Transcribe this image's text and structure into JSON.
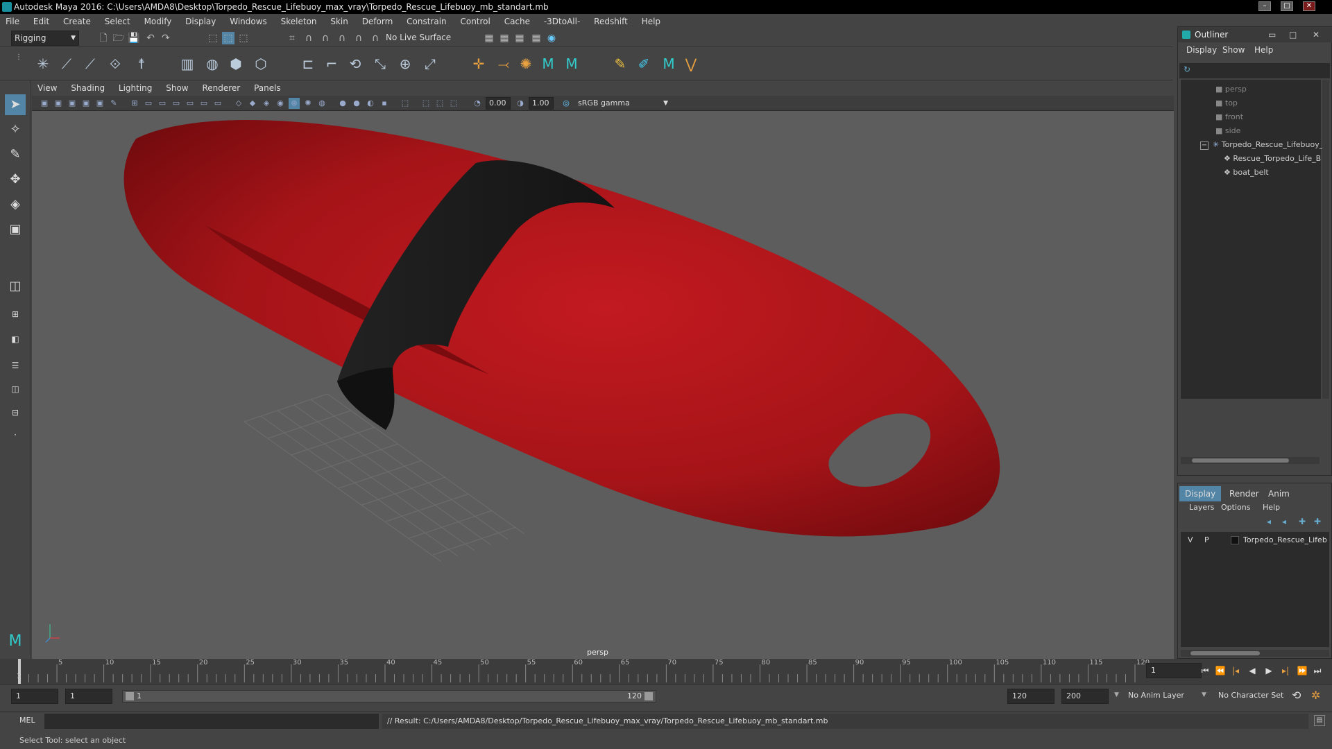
{
  "window": {
    "title": "Autodesk Maya 2016: C:\\Users\\AMDA8\\Desktop\\Torpedo_Rescue_Lifebuoy_max_vray\\Torpedo_Rescue_Lifebuoy_mb_standart.mb",
    "minimize": "–",
    "maximize": "□",
    "close": "✕"
  },
  "menubar": [
    "File",
    "Edit",
    "Create",
    "Select",
    "Modify",
    "Display",
    "Windows",
    "Skeleton",
    "Skin",
    "Deform",
    "Constrain",
    "Control",
    "Cache",
    "-3DtoAll-",
    "Redshift",
    "Help"
  ],
  "statusline": {
    "mode": "Rigging",
    "live_surface": "No Live Surface"
  },
  "panel": {
    "menu": [
      "View",
      "Shading",
      "Lighting",
      "Show",
      "Renderer",
      "Panels"
    ],
    "exposure": "0.00",
    "gamma": "1.00",
    "colorspace": "sRGB gamma",
    "camera_label": "persp"
  },
  "outliner": {
    "title": "Outliner",
    "menu": [
      "Display",
      "Show",
      "Help"
    ],
    "items": [
      {
        "label": "persp",
        "dim": true,
        "indent": 0
      },
      {
        "label": "top",
        "dim": true,
        "indent": 0
      },
      {
        "label": "front",
        "dim": true,
        "indent": 0
      },
      {
        "label": "side",
        "dim": true,
        "indent": 0
      },
      {
        "label": "Torpedo_Rescue_Lifebuoy_",
        "dim": false,
        "indent": 0
      },
      {
        "label": "Rescue_Torpedo_Life_B",
        "dim": false,
        "indent": 1
      },
      {
        "label": "boat_belt",
        "dim": false,
        "indent": 1
      }
    ],
    "expand_toggle": "−"
  },
  "layers": {
    "tabs": [
      "Display",
      "Render",
      "Anim"
    ],
    "menu": [
      "Layers",
      "Options",
      "Help"
    ],
    "row": {
      "v": "V",
      "p": "P",
      "name": "Torpedo_Rescue_Lifeb"
    }
  },
  "timeline": {
    "ticks": [
      "5",
      "10",
      "15",
      "20",
      "25",
      "30",
      "35",
      "40",
      "45",
      "50",
      "55",
      "60",
      "65",
      "70",
      "75",
      "80",
      "85",
      "90",
      "95",
      "100",
      "105",
      "110",
      "115",
      "120"
    ],
    "first_tick": "1",
    "current_frame": "1"
  },
  "range": {
    "start": "1",
    "playback_start": "1",
    "slider_start": "1",
    "slider_end": "120",
    "playback_end": "120",
    "end": "200",
    "anim_layer": "No Anim Layer",
    "char_set": "No Character Set"
  },
  "command": {
    "lang": "MEL",
    "result": "// Result: C:/Users/AMDA8/Desktop/Torpedo_Rescue_Lifebuoy_max_vray/Torpedo_Rescue_Lifebuoy_mb_standart.mb"
  },
  "help_line": "Select Tool: select an object",
  "colors": {
    "buoy_red": "#b0141a",
    "belt": "#1c1c1c",
    "viewport_bg": "#5d5d5d"
  }
}
